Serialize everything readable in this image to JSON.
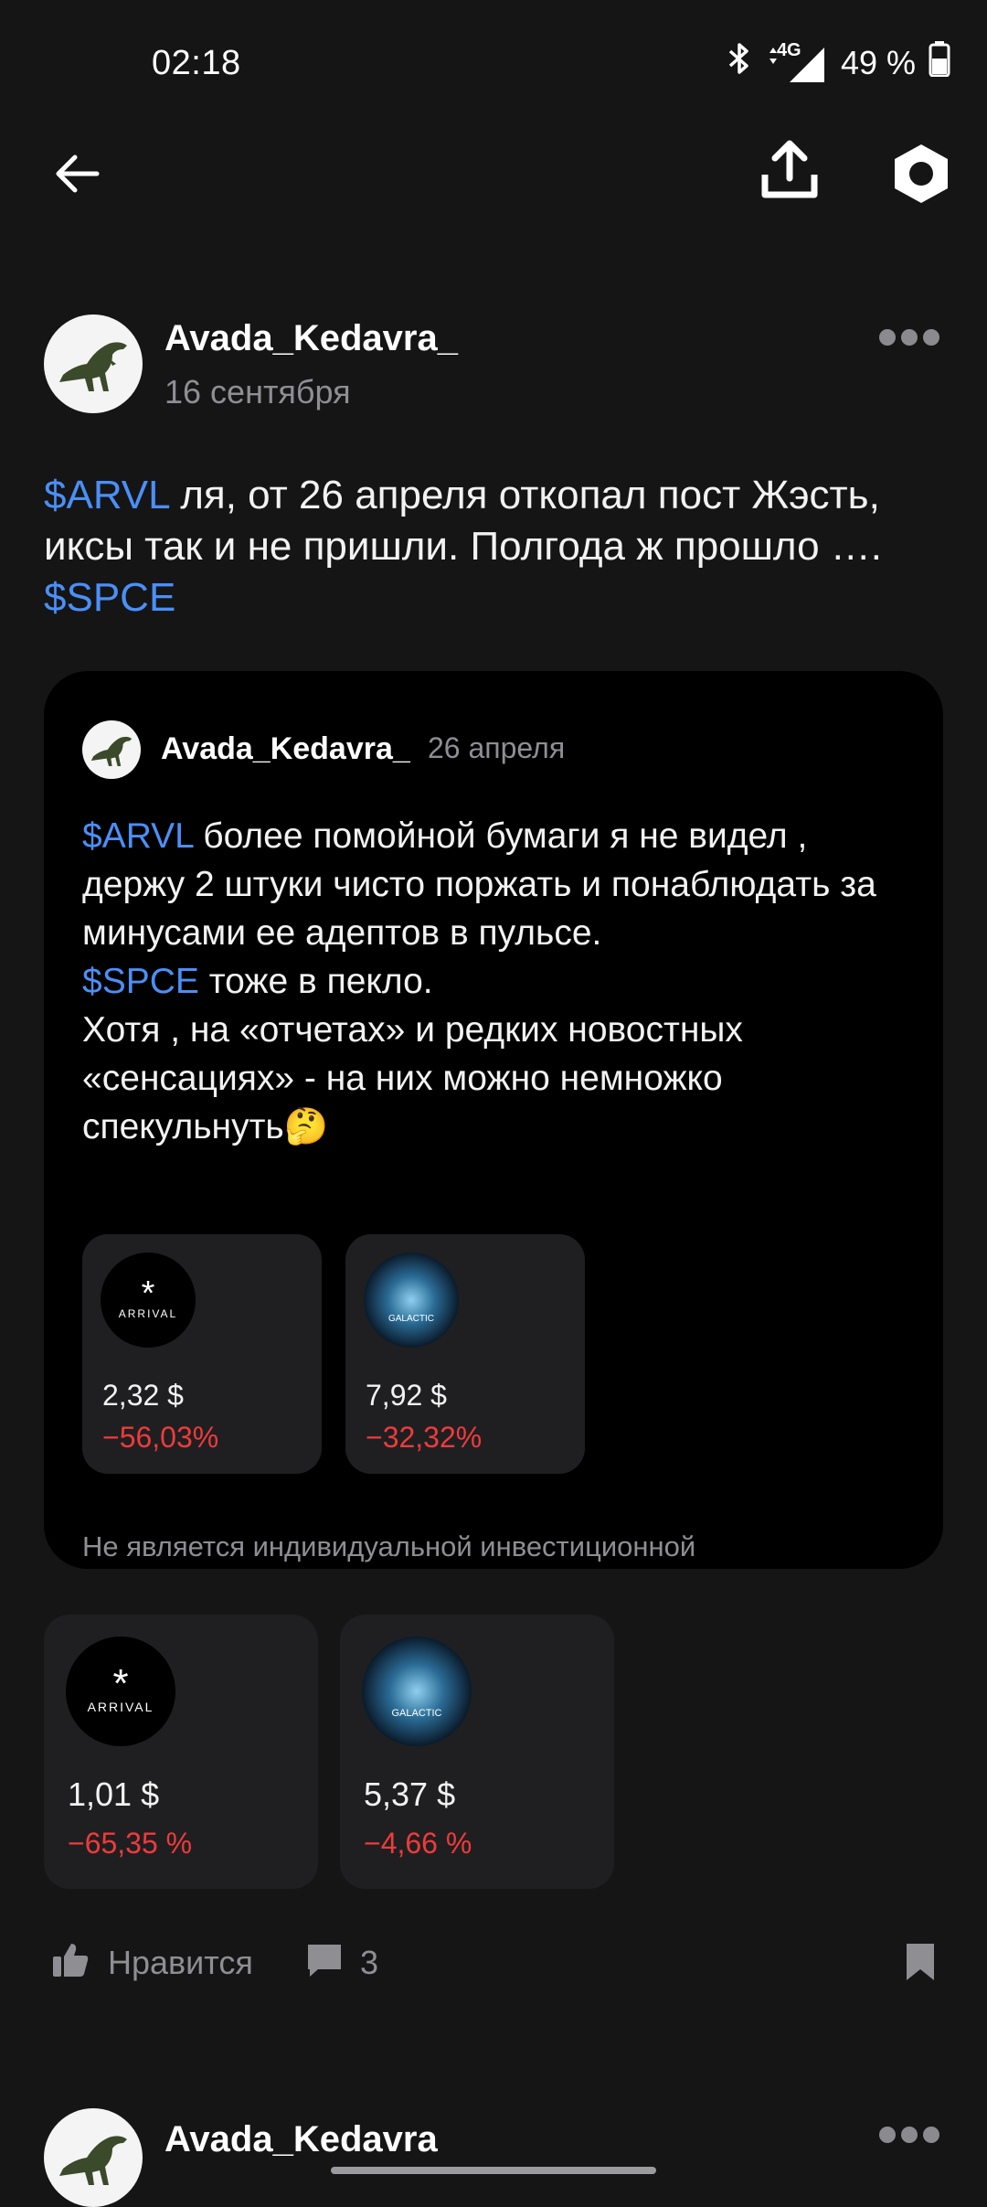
{
  "status_bar": {
    "time": "02:18",
    "network": "4G",
    "battery": "49 %",
    "icons": [
      "bluetooth-icon",
      "signal-icon",
      "battery-icon"
    ]
  },
  "top_bar": {
    "icons": [
      "back-arrow-icon",
      "share-icon",
      "settings-hexagon-icon"
    ]
  },
  "post": {
    "author": "Avada_Kedavra_",
    "date": "16 сентября",
    "text": {
      "ticker1": "$ARVL",
      "part1": " ля, от 26 апреля откопал пост Жэсть, иксы так и не пришли. Полгода ж прошло …. ",
      "ticker2": "$SPCE"
    },
    "quoted": {
      "author": "Avada_Kedavra_",
      "date": "26 апреля",
      "ticker1": "$ARVL",
      "line1": " более помойной бумаги я не видел , держу 2 штуки чисто поржать и понаблюдать за минусами ее адептов в пульсе.",
      "ticker2": "$SPCE",
      "line2": " тоже в пекло.",
      "line3": "Хотя , на «отчетах» и редких новостных «сенсациях» - на них можно немножко спекульнуть",
      "emoji": "🤔",
      "assets": [
        {
          "logo": "ARRIVAL",
          "price": "2,32 $",
          "change": "−56,03%"
        },
        {
          "logo": "GALACTIC",
          "price": "7,92 $",
          "change": "−32,32%"
        }
      ],
      "disclaimer": "Не является индивидуальной инвестиционной"
    },
    "assets": [
      {
        "logo": "ARRIVAL",
        "price": "1,01  $",
        "change": "−65,35 %"
      },
      {
        "logo": "GALACTIC",
        "price": "5,37  $",
        "change": "−4,66 %"
      }
    ],
    "actions": {
      "like_label": "Нравится",
      "comments_count": "3"
    }
  },
  "next_post": {
    "author": "Avada_Kedavra"
  },
  "colors": {
    "background": "#151516",
    "ticker": "#4b8ff7",
    "negative": "#ee3b3b",
    "card": "#1f1f21"
  }
}
